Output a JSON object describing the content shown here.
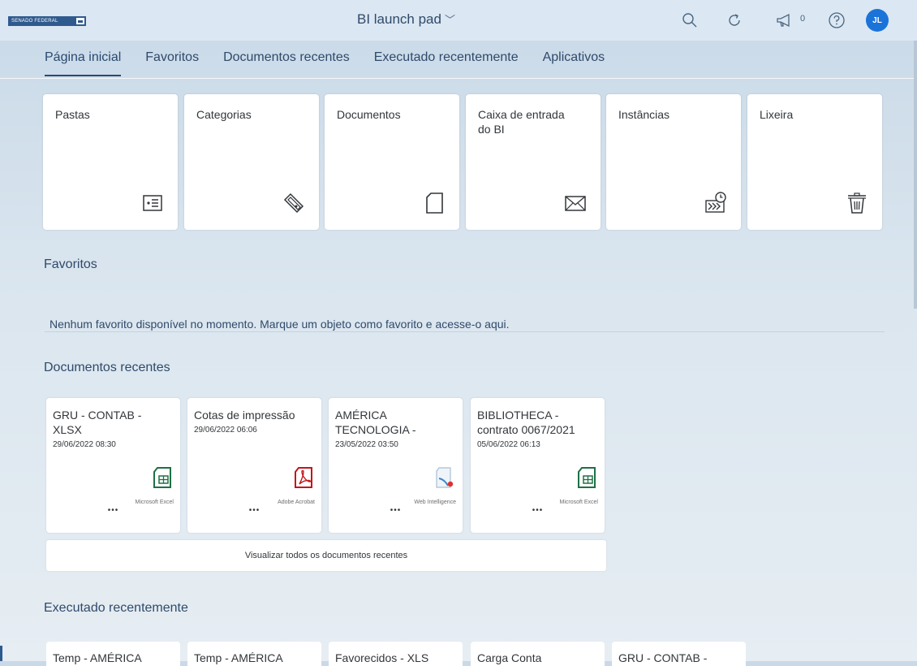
{
  "shell": {
    "logo_text": "SENADO FEDERAL",
    "app_title": "BI launch pad",
    "notification_count": "0",
    "avatar_initials": "JL"
  },
  "tabs": [
    {
      "label": "Página inicial",
      "active": true
    },
    {
      "label": "Favoritos"
    },
    {
      "label": "Documentos recentes"
    },
    {
      "label": "Executado recentemente"
    },
    {
      "label": "Aplicativos"
    }
  ],
  "tiles": [
    {
      "title": "Pastas",
      "icon": "folder-card-icon"
    },
    {
      "title": "Categorias",
      "icon": "tag-icon"
    },
    {
      "title": "Documentos",
      "icon": "document-icon"
    },
    {
      "title": "Caixa de entrada do BI",
      "icon": "envelope-icon"
    },
    {
      "title": "Instâncias",
      "icon": "instances-icon"
    },
    {
      "title": "Lixeira",
      "icon": "trash-icon"
    }
  ],
  "favorites": {
    "title": "Favoritos",
    "empty_message": "Nenhum favorito disponível no momento. Marque um objeto como favorito e acesse-o aqui."
  },
  "recent_documents": {
    "title": "Documentos recentes",
    "items": [
      {
        "title_line1": "GRU - CONTAB -",
        "title_line2": "XLSX",
        "date": "29/06/2022 08:30",
        "type": "Microsoft Excel",
        "more": "•••"
      },
      {
        "title_line1": "Cotas de impressão",
        "title_line2": "",
        "date": "29/06/2022 06:06",
        "type": "Adobe Acrobat",
        "more": "•••"
      },
      {
        "title_line1": "AMÉRICA",
        "title_line2": "TECNOLOGIA -",
        "date": "23/05/2022 03:50",
        "type": "Web Intelligence",
        "more": "•••"
      },
      {
        "title_line1": "BIBLIOTHECA -",
        "title_line2": "contrato 0067/2021",
        "date": "05/06/2022 06:13",
        "type": "Microsoft Excel",
        "more": "•••"
      }
    ],
    "view_all_label": "Visualizar todos os documentos recentes"
  },
  "recently_run": {
    "title": "Executado recentemente",
    "items": [
      {
        "title": "Temp - AMÉRICA"
      },
      {
        "title": "Temp - AMÉRICA"
      },
      {
        "title": "Favorecidos - XLS"
      },
      {
        "title": "Carga Conta"
      },
      {
        "title": "GRU - CONTAB -"
      }
    ]
  },
  "colors": {
    "accent": "#2a4a70",
    "avatar": "#1a73d9",
    "excel": "#1e7145",
    "acrobat": "#c4161c",
    "webi_dot": "#e03030"
  }
}
